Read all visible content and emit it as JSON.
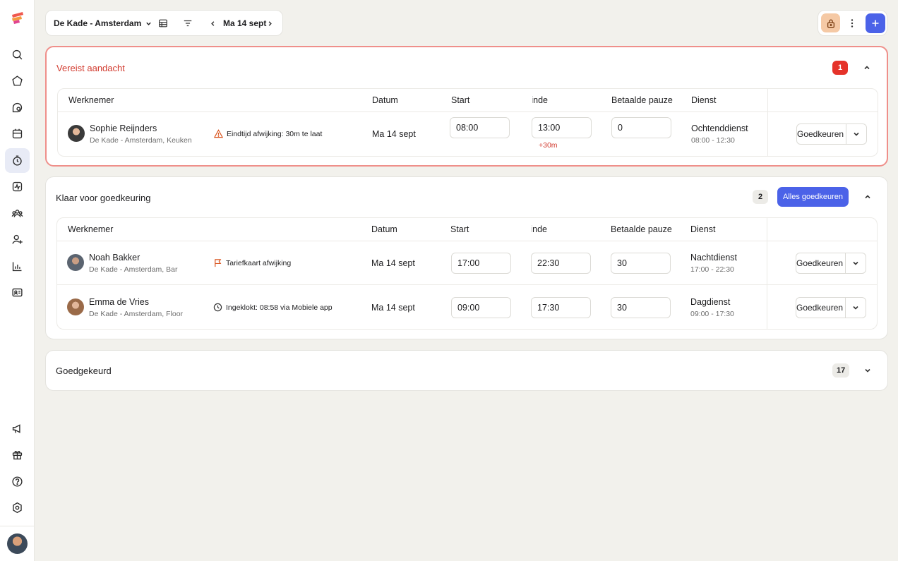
{
  "toolbar": {
    "location": "De Kade - Amsterdam",
    "date": "Ma 14 sept"
  },
  "sections": {
    "attention": {
      "title": "Vereist aandacht",
      "count": "1"
    },
    "ready": {
      "title": "Klaar voor goedkeuring",
      "count": "2",
      "approve_all": "Alles goedkeuren"
    },
    "approved": {
      "title": "Goedgekeurd",
      "count": "17"
    }
  },
  "columns": {
    "employee": "Werknemer",
    "date": "Datum",
    "start": "Start",
    "end": "Einde",
    "paid_break": "Betaalde pauze",
    "shift": "Dienst"
  },
  "attention_rows": [
    {
      "name": "Sophie Reijnders",
      "location": "De Kade - Amsterdam, Keuken",
      "note": "Eindtijd afwijking: 30m te laat",
      "date": "Ma 14 sept",
      "start": "08:00",
      "end": "13:00",
      "end_diff": "+30m",
      "break": "0",
      "shift_name": "Ochtenddienst",
      "shift_time": "08:00 - 12:30",
      "action": "Goedkeuren"
    }
  ],
  "ready_rows": [
    {
      "name": "Noah Bakker",
      "location": "De Kade - Amsterdam, Bar",
      "note": "Tariefkaart afwijking",
      "date": "Ma 14 sept",
      "start": "17:00",
      "end": "22:30",
      "break": "30",
      "shift_name": "Nachtdienst",
      "shift_time": "17:00 - 22:30",
      "action": "Goedkeuren"
    },
    {
      "name": "Emma de Vries",
      "location": "De Kade - Amsterdam, Floor",
      "note": "Ingeklokt: 08:58 via Mobiele app",
      "date": "Ma 14 sept",
      "start": "09:00",
      "end": "17:30",
      "break": "30",
      "shift_name": "Dagdienst",
      "shift_time": "09:00 - 17:30",
      "action": "Goedkeuren"
    }
  ],
  "colors": {
    "accent": "#4b62e8",
    "alert": "#e5332a",
    "alert_border": "#ef8f8a",
    "background": "#f2f1ec"
  }
}
